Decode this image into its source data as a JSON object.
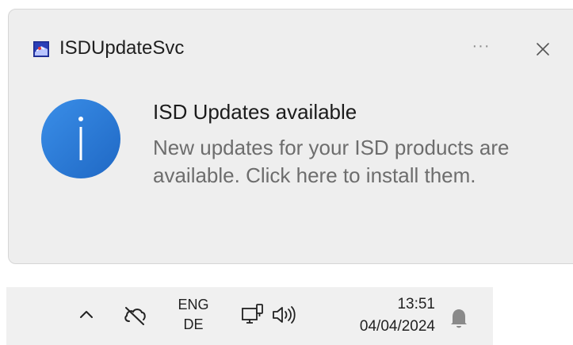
{
  "notification": {
    "app_name": "ISDUpdateSvc",
    "more_label": "···",
    "title": "ISD Updates available",
    "body": "New updates for your ISD products are available. Click here to install them.",
    "icons": {
      "app": "isd-app-icon",
      "main": "info-icon",
      "close": "close-icon"
    },
    "accent_color": "#2f7fd6"
  },
  "taskbar": {
    "language_line1": "ENG",
    "language_line2": "DE",
    "time": "13:51",
    "date": "04/04/2024",
    "icons": [
      "chevron-up-icon",
      "cloud-offline-icon",
      "network-icon",
      "volume-icon",
      "bell-icon"
    ]
  }
}
